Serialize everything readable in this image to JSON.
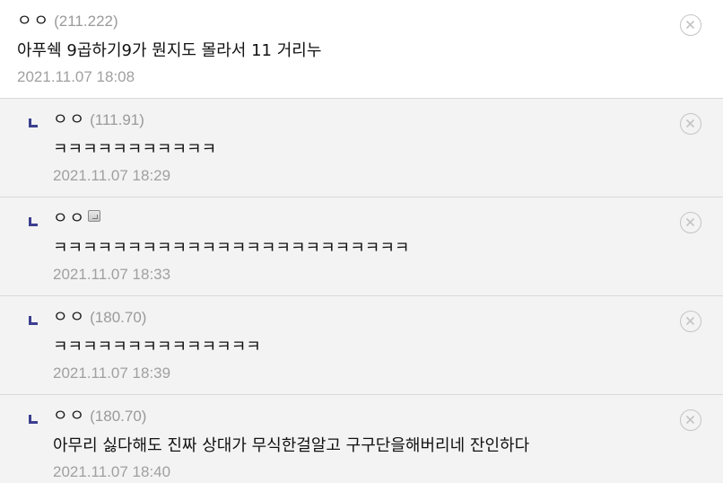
{
  "comments": [
    {
      "type": "top",
      "nick": "ㅇㅇ",
      "ip": "(211.222)",
      "mobile": false,
      "text": "아푸쉑 9곱하기9가 뭔지도 몰라서 11 거리누",
      "date": "2021.11.07 18:08"
    },
    {
      "type": "reply",
      "nick": "ㅇㅇ",
      "ip": "(111.91)",
      "mobile": false,
      "text": "ㅋㅋㅋㅋㅋㅋㅋㅋㅋㅋㅋ",
      "date": "2021.11.07 18:29"
    },
    {
      "type": "reply",
      "nick": "ㅇㅇ",
      "ip": "",
      "mobile": true,
      "text": "ㅋㅋㅋㅋㅋㅋㅋㅋㅋㅋㅋㅋㅋㅋㅋㅋㅋㅋㅋㅋㅋㅋㅋㅋ",
      "date": "2021.11.07 18:33"
    },
    {
      "type": "reply",
      "nick": "ㅇㅇ",
      "ip": "(180.70)",
      "mobile": false,
      "text": "ㅋㅋㅋㅋㅋㅋㅋㅋㅋㅋㅋㅋㅋㅋ",
      "date": "2021.11.07 18:39"
    },
    {
      "type": "reply",
      "nick": "ㅇㅇ",
      "ip": "(180.70)",
      "mobile": false,
      "text": "아무리 싫다해도 진짜 상대가 무식한걸알고 구구단을해버리네 잔인하다",
      "date": "2021.11.07 18:40"
    }
  ],
  "icons": {
    "delete": "close-circle-icon",
    "reply": "reply-arrow-icon",
    "mobile": "mobile-icon"
  },
  "colors": {
    "reply_mark": "#3b3f8f",
    "meta_gray": "#9a9a9a"
  }
}
